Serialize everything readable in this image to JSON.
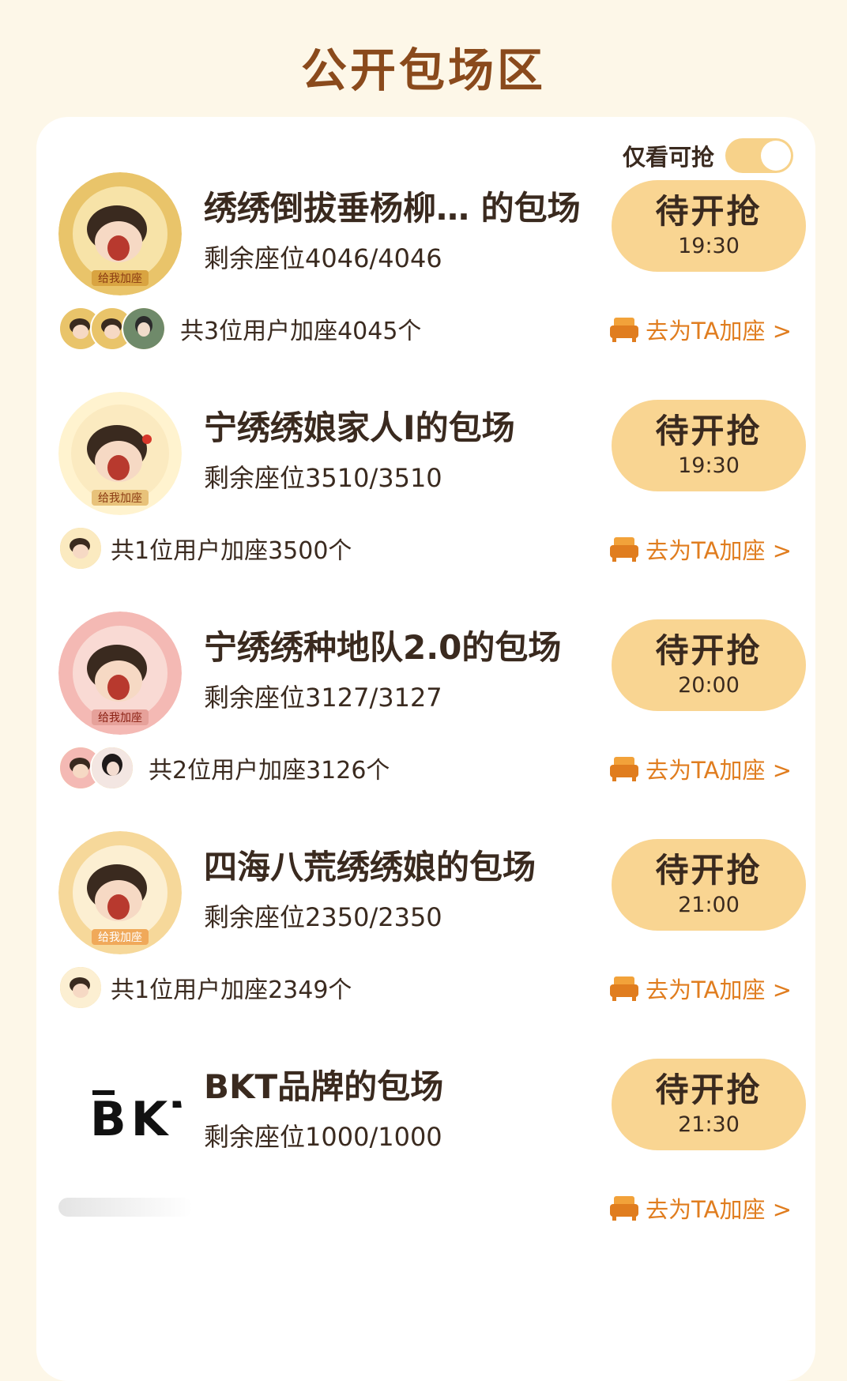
{
  "page": {
    "title": "公开包场区"
  },
  "filter": {
    "label": "仅看可抢",
    "toggle_on": true
  },
  "colors": {
    "accent": "#e07d1f",
    "title_brown": "#8a4a1c",
    "button_bg": "#f9d592",
    "background": "#fdf7e8"
  },
  "sessions": [
    {
      "title": "绣绣倒拔垂杨柳… 的包场",
      "seats": "剩余座位4046/4046",
      "button_label": "待开抢",
      "time": "19:30",
      "users_text": "共3位用户加座4045个",
      "add_label": "去为TA加座 >",
      "avatar_badge": "绣绣倒拔垂杨柳",
      "avatar_sign": "给我加座"
    },
    {
      "title": "宁绣绣娘家人I的包场",
      "seats": "剩余座位3510/3510",
      "button_label": "待开抢",
      "time": "19:30",
      "users_text": "共1位用户加座3500个",
      "add_label": "去为TA加座 >",
      "avatar_badge": "宁绣绣娘家人I",
      "avatar_sign": "给我加座"
    },
    {
      "title": "宁绣绣种地队2.0的包场",
      "seats": "剩余座位3127/3127",
      "button_label": "待开抢",
      "time": "20:00",
      "users_text": "共2位用户加座3126个",
      "add_label": "去为TA加座 >",
      "avatar_badge": "宁绣绣种地队",
      "avatar_sign": "给我加座"
    },
    {
      "title": "四海八荒绣绣娘的包场",
      "seats": "剩余座位2350/2350",
      "button_label": "待开抢",
      "time": "21:00",
      "users_text": "共1位用户加座2349个",
      "add_label": "去为TA加座 >",
      "avatar_badge": "四海八荒绣绣娘",
      "avatar_sign": "给我加座"
    },
    {
      "title": "BKT品牌的包场",
      "seats": "剩余座位1000/1000",
      "button_label": "待开抢",
      "time": "21:30",
      "users_text": "",
      "add_label": "去为TA加座 >",
      "logo_text": "BKT"
    }
  ]
}
